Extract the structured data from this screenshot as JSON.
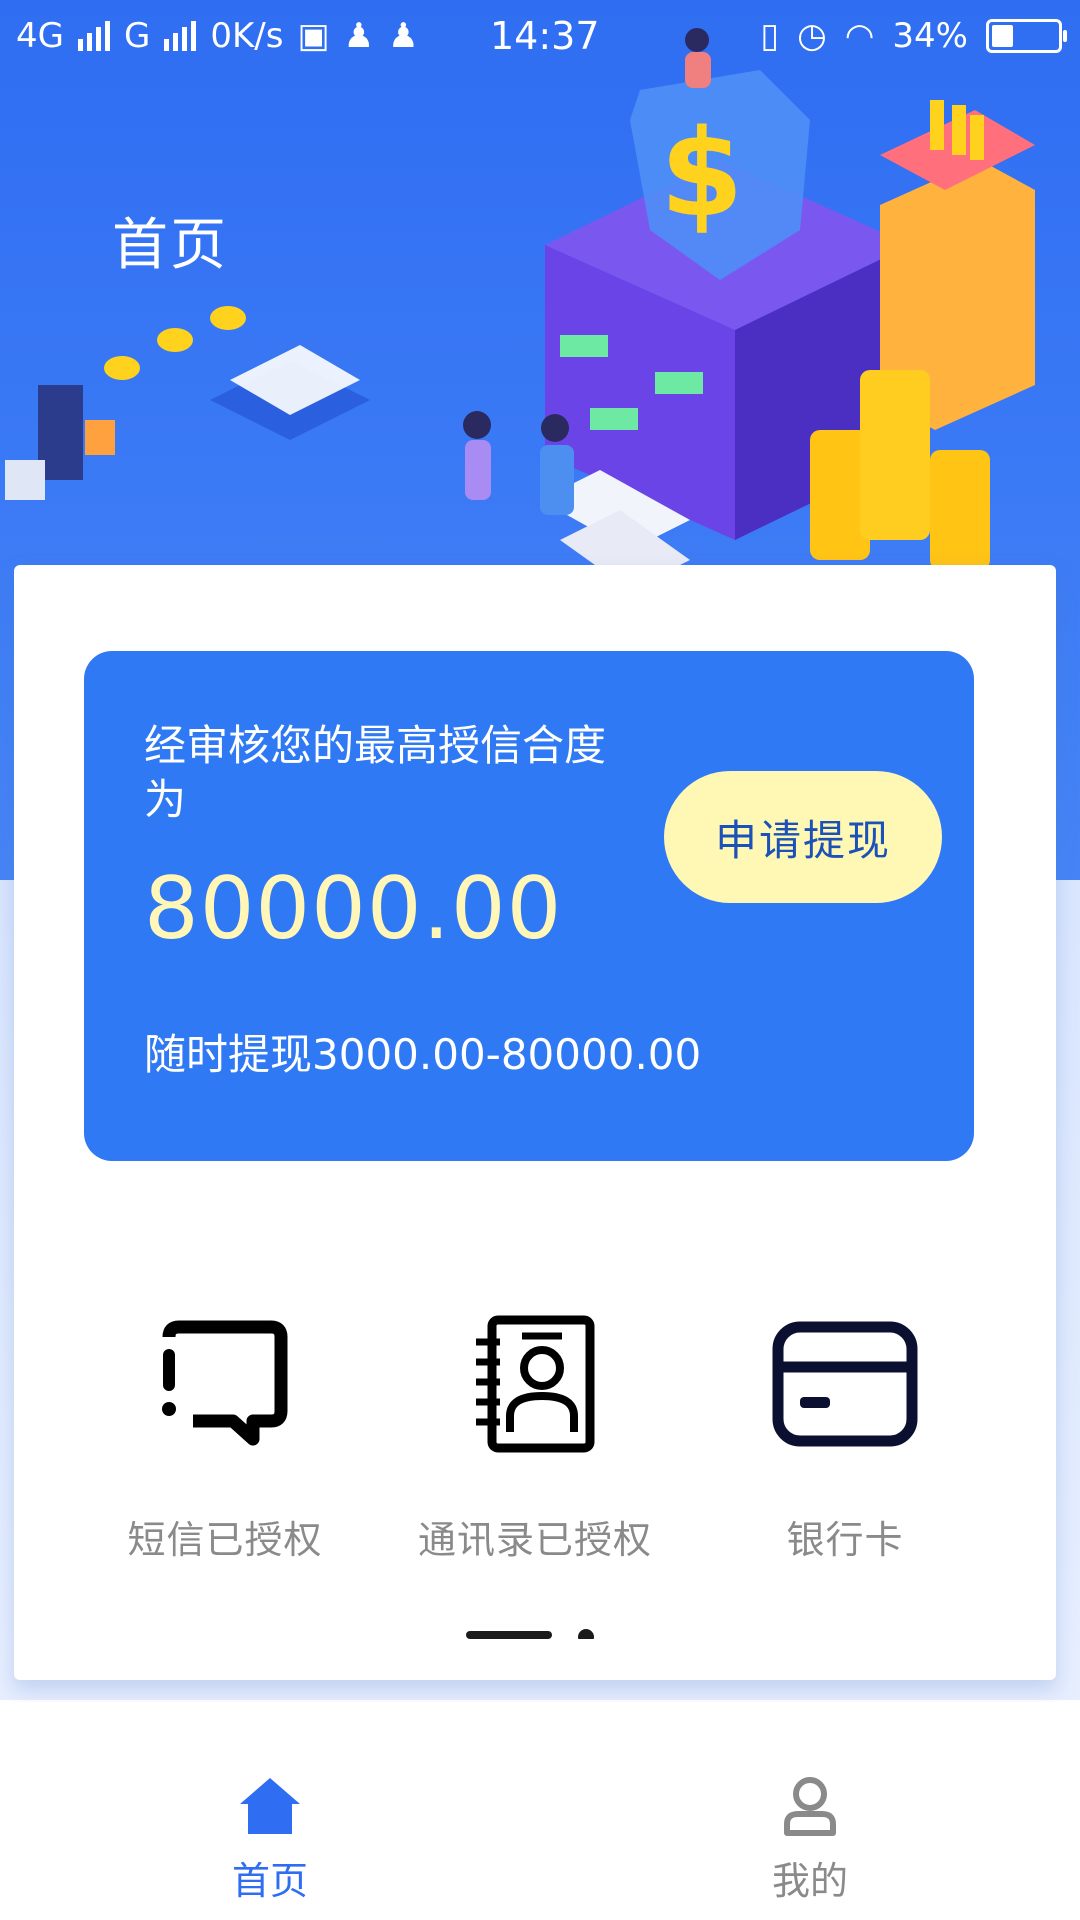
{
  "status_bar": {
    "network_1": "4G",
    "network_2": "G",
    "speed": "0K/s",
    "time": "14:37",
    "battery": "34%"
  },
  "header": {
    "title": "首页"
  },
  "credit": {
    "label": "经审核您的最高授信合度为",
    "amount": "80000.00",
    "range": "随时提现3000.00-80000.00",
    "apply_button": "申请提现"
  },
  "auth_items": [
    {
      "label": "短信已授权",
      "icon": "message-alert-icon"
    },
    {
      "label": "通讯录已授权",
      "icon": "contacts-book-icon"
    },
    {
      "label": "银行卡",
      "icon": "bank-card-icon"
    }
  ],
  "bottom_nav": {
    "home": {
      "label": "首页",
      "icon": "home-icon",
      "active": true
    },
    "mine": {
      "label": "我的",
      "icon": "user-icon",
      "active": false
    }
  },
  "colors": {
    "primary": "#2f6df2",
    "card": "#2f79f4",
    "button": "#fef8b4",
    "amount": "#fff6b8",
    "muted": "#8a8a8a"
  }
}
